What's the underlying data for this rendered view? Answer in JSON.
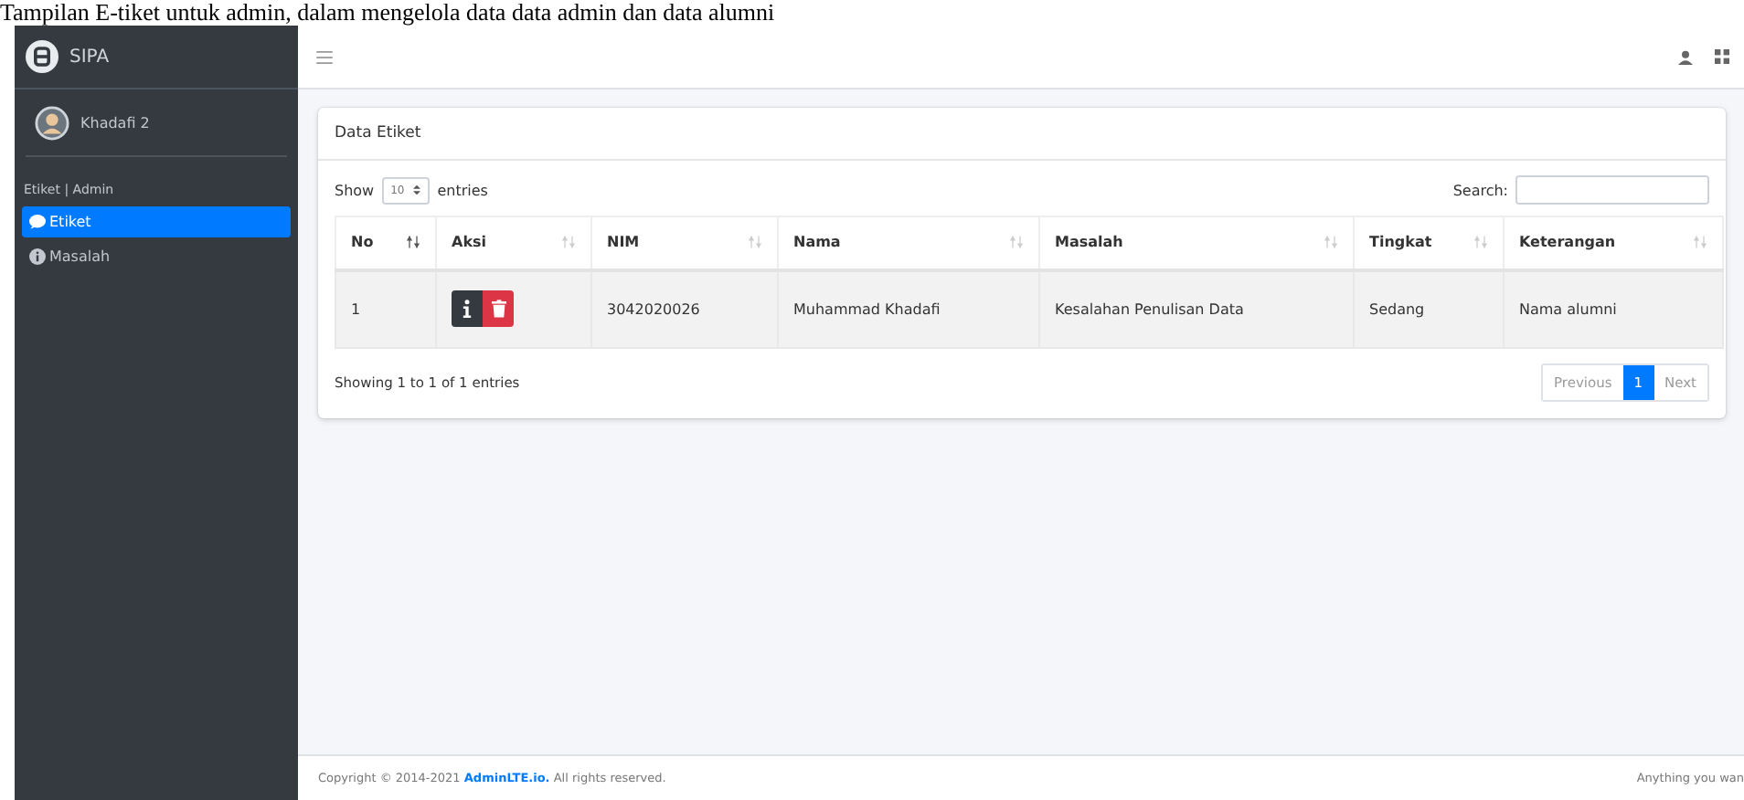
{
  "caption": "Tampilan E-tiket untuk admin, dalam mengelola data data admin dan data alumni",
  "brand": "SIPA",
  "user": "Khadafi 2",
  "sidebar": {
    "header": "Etiket | Admin",
    "items": [
      {
        "label": "Etiket",
        "selected": true
      },
      {
        "label": "Masalah",
        "selected": false
      }
    ]
  },
  "card": {
    "title": "Data Etiket",
    "show_label": "Show",
    "page_size": "10",
    "entries_label": "entries",
    "search_label": "Search:"
  },
  "table": {
    "columns": [
      {
        "label": "No",
        "sorted": true
      },
      {
        "label": "Aksi",
        "sorted": false
      },
      {
        "label": "NIM",
        "sorted": false
      },
      {
        "label": "Nama",
        "sorted": false
      },
      {
        "label": "Masalah",
        "sorted": false
      },
      {
        "label": "Tingkat",
        "sorted": false
      },
      {
        "label": "Keterangan",
        "sorted": false
      }
    ],
    "rows": [
      {
        "no": "1",
        "nim": "3042020026",
        "nama": "Muhammad Khadafi",
        "masalah": "Kesalahan Penulisan Data",
        "tingkat": "Sedang",
        "keterangan": "Nama alumni"
      }
    ]
  },
  "info": "Showing 1 to 1 of 1 entries",
  "pagination": [
    {
      "label": "Previous",
      "selected": false
    },
    {
      "label": "1",
      "selected": true
    },
    {
      "label": "Next",
      "selected": false
    }
  ],
  "footer": {
    "text_before": "Copyright © 2014-2021 ",
    "link": "AdminLTE.io.",
    "text_after": " All rights reserved.",
    "right": "Anything you wan"
  }
}
